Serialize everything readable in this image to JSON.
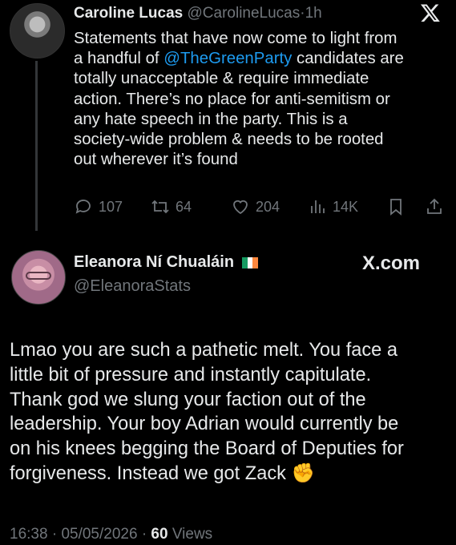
{
  "tweet1": {
    "author_name": "Caroline Lucas",
    "handle": "@CarolineLucas",
    "separator": "·",
    "time": "1h",
    "lines": [
      "Statements that have now come to light from",
      "a handful of ",
      "totally unacceptable & require immediate",
      "action. There’s no place for anti-semitism or",
      "any hate speech in the party. This is a",
      "society-wide problem & needs to be rooted",
      "out wherever it’s found"
    ],
    "mention": "@TheGreenParty",
    "line2_suffix": " candidates are",
    "actions": {
      "replies": "107",
      "reposts": "64",
      "likes": "204",
      "views": "14K"
    }
  },
  "tweet2": {
    "author_name": "Eleanora Ní Chualáin",
    "handle": "@EleanoraStats",
    "flag_colors": [
      "#169b62",
      "#ffffff",
      "#ff883e"
    ],
    "watermark": "X.com",
    "lines": [
      "Lmao you are such a pathetic melt. You face a",
      "little bit of pressure and instantly capitulate.",
      "Thank god we slung your faction out of the",
      "leadership. Your boy Adrian would currently be",
      "on his knees begging the Board of Deputies for",
      "forgiveness. Instead we got Zack ✊"
    ],
    "time": "16:38",
    "date": "05/05/2026",
    "separator": "·",
    "views_count": "60",
    "views_label": "Views"
  },
  "colors": {
    "background": "#000000",
    "text": "#e7e9ea",
    "muted": "#71767b",
    "link": "#1d9bf0"
  }
}
